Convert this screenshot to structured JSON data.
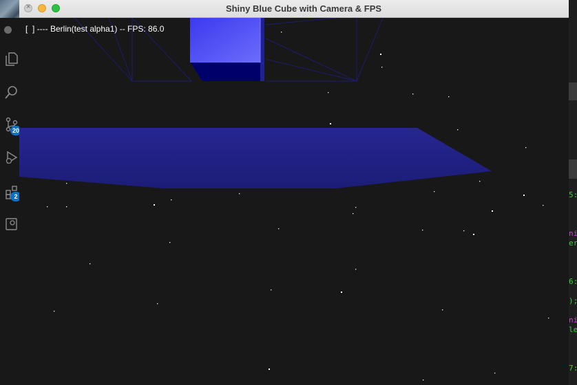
{
  "window": {
    "title": "Shiny Blue Cube with Camera & FPS",
    "controls": [
      "close",
      "minimize",
      "maximize"
    ]
  },
  "hud": {
    "text": "[  ] ---- Berlin(test alpha1) -- FPS: 86.0"
  },
  "scene": {
    "background_color": "#181818",
    "cube_colors": {
      "front": "#4a4af5",
      "side": "#202090",
      "bottom": "#00006a"
    },
    "plane_color": "#23239a",
    "wireframe_color": "#1a1a6a",
    "star_color": "#ffffff"
  },
  "background_editor": {
    "activity_icons": [
      "files-icon",
      "search-icon",
      "source-control-icon",
      "debug-icon",
      "extensions-icon",
      "remote-explorer-icon"
    ],
    "badges": [
      "20",
      "2"
    ],
    "code_fragments": [
      {
        "text": "5:",
        "color": "#3cd23c"
      },
      {
        "text": "ni",
        "color": "#c04cc4"
      },
      {
        "text": "er",
        "color": "#3cd23c"
      },
      {
        "text": "6:",
        "color": "#3cd23c"
      },
      {
        "text": ");",
        "color": "#3cd23c"
      },
      {
        "text": "ni",
        "color": "#c04cc4"
      },
      {
        "text": "le",
        "color": "#3cd23c"
      },
      {
        "text": "7:",
        "color": "#3cd23c"
      }
    ]
  }
}
